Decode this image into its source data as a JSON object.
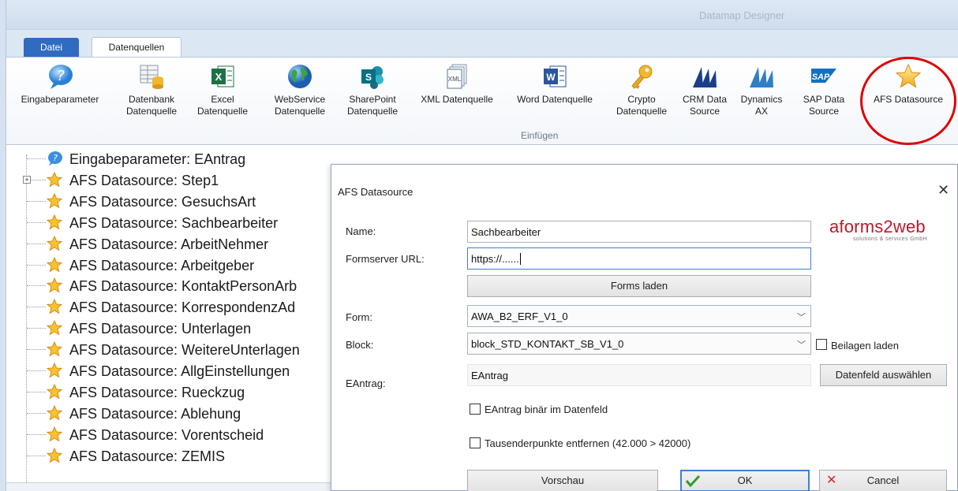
{
  "app": {
    "title": "Datamap Designer"
  },
  "tabs": {
    "file": "Datei",
    "datasources": "Datenquellen"
  },
  "ribbon": {
    "group_label": "Einfügen",
    "buttons": [
      {
        "label": "Eingabeparameter",
        "icon": "help-bubble-icon"
      },
      {
        "label": "Datenbank\nDatenquelle",
        "icon": "database-table-icon"
      },
      {
        "label": "Excel\nDatenquelle",
        "icon": "excel-icon"
      },
      {
        "label": "WebService\nDatenquelle",
        "icon": "globe-icon"
      },
      {
        "label": "SharePoint\nDatenquelle",
        "icon": "sharepoint-icon"
      },
      {
        "label": "XML Datenquelle",
        "icon": "xml-document-icon"
      },
      {
        "label": "Word Datenquelle",
        "icon": "word-icon"
      },
      {
        "label": "Crypto\nDatenquelle",
        "icon": "key-icon"
      },
      {
        "label": "CRM Data\nSource",
        "icon": "dynamics-crm-icon"
      },
      {
        "label": "Dynamics\nAX",
        "icon": "dynamics-ax-icon"
      },
      {
        "label": "SAP Data\nSource",
        "icon": "sap-icon"
      },
      {
        "label": "AFS Datasource",
        "icon": "star-icon"
      }
    ]
  },
  "tree": {
    "items": [
      {
        "label": "Eingabeparameter: EAntrag",
        "icon": "help-bubble-icon"
      },
      {
        "label": "AFS Datasource: Step1",
        "icon": "star-icon",
        "expandable": true
      },
      {
        "label": "AFS Datasource: GesuchsArt",
        "icon": "star-icon"
      },
      {
        "label": "AFS Datasource: Sachbearbeiter",
        "icon": "star-icon"
      },
      {
        "label": "AFS Datasource: ArbeitNehmer",
        "icon": "star-icon"
      },
      {
        "label": "AFS Datasource: Arbeitgeber",
        "icon": "star-icon"
      },
      {
        "label": "AFS Datasource: KontaktPersonArb",
        "icon": "star-icon"
      },
      {
        "label": "AFS Datasource: KorrespondenzAd",
        "icon": "star-icon"
      },
      {
        "label": "AFS Datasource: Unterlagen",
        "icon": "star-icon"
      },
      {
        "label": "AFS Datasource: WeitereUnterlagen",
        "icon": "star-icon"
      },
      {
        "label": "AFS Datasource: AllgEinstellungen",
        "icon": "star-icon"
      },
      {
        "label": "AFS Datasource: Rueckzug",
        "icon": "star-icon"
      },
      {
        "label": "AFS Datasource: Ablehung",
        "icon": "star-icon"
      },
      {
        "label": "AFS Datasource: Vorentscheid",
        "icon": "star-icon"
      },
      {
        "label": "AFS Datasource: ZEMIS",
        "icon": "star-icon"
      }
    ]
  },
  "dialog": {
    "title": "AFS Datasource",
    "logo": {
      "brand": "aforms2web",
      "tagline": "solutions & services GmbH"
    },
    "name_label": "Name:",
    "name_value": "Sachbearbeiter",
    "url_label": "Formserver URL:",
    "url_value": "https://......",
    "forms_load_button": "Forms laden",
    "form_label": "Form:",
    "form_value": "AWA_B2_ERF_V1_0",
    "block_label": "Block:",
    "block_value": "block_STD_KONTAKT_SB_V1_0",
    "attachments_label": "Beilagen laden",
    "eantrag_label": "EAntrag:",
    "eantrag_value": "EAntrag",
    "select_field_button": "Datenfeld auswählen",
    "binary_label": "EAntrag binär im Datenfeld",
    "thousands_label": "Tausenderpunkte entfernen (42.000 > 42000)",
    "preview_button": "Vorschau",
    "ok_button": "OK",
    "cancel_button": "Cancel"
  },
  "colors": {
    "accent": "#2f6bc0",
    "annotation": "#e00000",
    "brand": "#c0182a"
  }
}
